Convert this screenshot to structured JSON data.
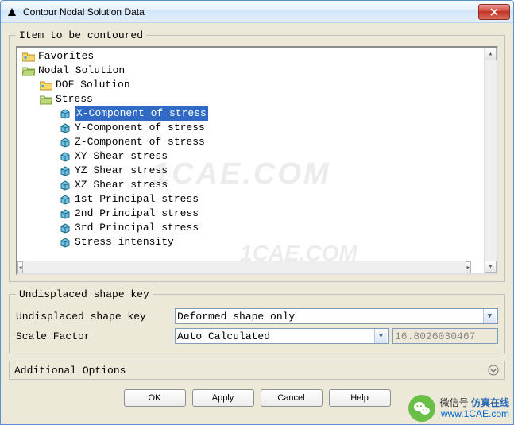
{
  "title": "Contour Nodal Solution Data",
  "groupbox1_legend": "Item to be contoured",
  "tree": {
    "favorites": "Favorites",
    "nodal_solution": "Nodal Solution",
    "dof_solution": "DOF Solution",
    "stress": "Stress",
    "items": [
      "X-Component of stress",
      "Y-Component of stress",
      "Z-Component of stress",
      "XY Shear stress",
      "YZ Shear stress",
      "XZ Shear stress",
      "1st Principal stress",
      "2nd Principal stress",
      "3rd Principal stress",
      "Stress intensity"
    ]
  },
  "groupbox2_legend": "Undisplaced shape key",
  "undisplaced": {
    "label": "Undisplaced shape key",
    "value": "Deformed shape only",
    "scale_label": "Scale Factor",
    "scale_value": "Auto Calculated",
    "scale_number": "16.8026030467"
  },
  "additional_options": "Additional Options",
  "buttons": {
    "ok": "OK",
    "apply": "Apply",
    "cancel": "Cancel",
    "help": "Help"
  },
  "overlay": {
    "wechat_label": "微信号",
    "brand": "仿真在线",
    "url": "www.1CAE.com"
  },
  "watermark1": "1CAE.COM",
  "watermark2": "1CAE.COM"
}
